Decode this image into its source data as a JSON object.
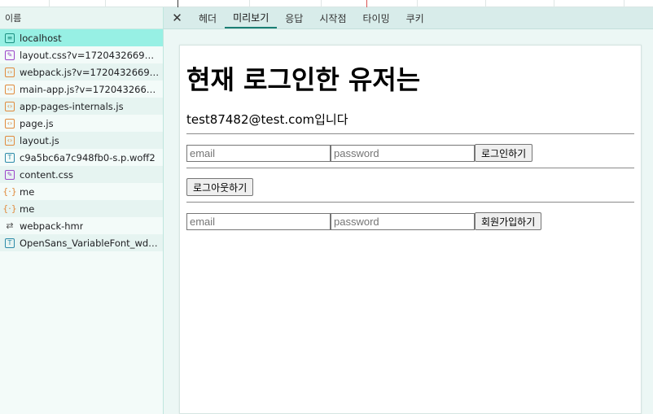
{
  "list_header": "이름",
  "requests": [
    {
      "name": "localhost",
      "icon": "document-icon",
      "kind": "doc"
    },
    {
      "name": "layout.css?v=1720432669535",
      "icon": "css-file-icon",
      "kind": "css"
    },
    {
      "name": "webpack.js?v=1720432669535",
      "icon": "script-file-icon",
      "kind": "js"
    },
    {
      "name": "main-app.js?v=1720432669535",
      "icon": "script-file-icon",
      "kind": "js"
    },
    {
      "name": "app-pages-internals.js",
      "icon": "script-file-icon",
      "kind": "js"
    },
    {
      "name": "page.js",
      "icon": "script-file-icon",
      "kind": "js"
    },
    {
      "name": "layout.js",
      "icon": "script-file-icon",
      "kind": "js"
    },
    {
      "name": "c9a5bc6a7c948fb0-s.p.woff2",
      "icon": "font-file-icon",
      "kind": "font"
    },
    {
      "name": "content.css",
      "icon": "css-file-icon",
      "kind": "css"
    },
    {
      "name": "me",
      "icon": "fetch-icon",
      "kind": "fetch"
    },
    {
      "name": "me",
      "icon": "fetch-icon",
      "kind": "fetch"
    },
    {
      "name": "webpack-hmr",
      "icon": "websocket-icon",
      "kind": "ws"
    },
    {
      "name": "OpenSans_VariableFont_wdth...",
      "icon": "font-file-icon",
      "kind": "font"
    }
  ],
  "close_icon": "close-icon",
  "tabs": [
    {
      "label": "헤더"
    },
    {
      "label": "미리보기"
    },
    {
      "label": "응답"
    },
    {
      "label": "시작점"
    },
    {
      "label": "타이밍"
    },
    {
      "label": "쿠키"
    }
  ],
  "active_tab_index": 1,
  "preview": {
    "heading": "현재 로그인한 유저는",
    "user_text": "test87482@test.com입니다",
    "login_form": {
      "email_placeholder": "email",
      "password_placeholder": "password",
      "button": "로그인하기"
    },
    "logout_button": "로그아웃하기",
    "signup_form": {
      "email_placeholder": "email",
      "password_placeholder": "password",
      "button": "회원가입하기"
    }
  }
}
